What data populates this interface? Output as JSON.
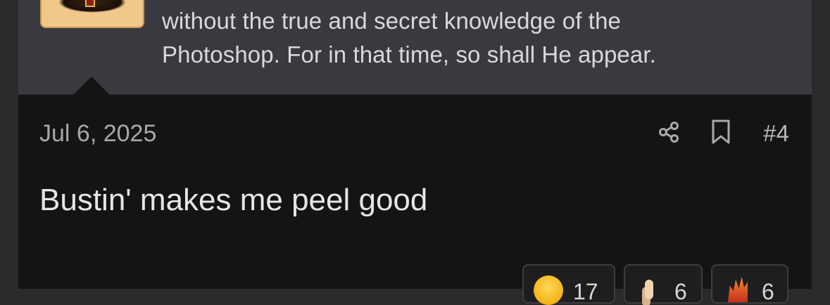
{
  "quote": {
    "line1": "without the true and secret knowledge of the",
    "line2": "Photoshop. For in that time, so shall He appear."
  },
  "post": {
    "date": "Jul 6, 2025",
    "number": "#4",
    "body": "Bustin' makes me peel good",
    "actions": {
      "share_icon": "share-icon",
      "bookmark_icon": "bookmark-icon"
    }
  },
  "reactions": [
    {
      "emoji": "laughing-emoji",
      "count": "17"
    },
    {
      "emoji": "thumbs-up-emoji",
      "count": "6"
    },
    {
      "emoji": "fire-emoji",
      "count": "6"
    }
  ],
  "colors": {
    "page_background": "#2a2a2d",
    "quote_background": "#393a3f",
    "post_background": "#141414",
    "text_primary": "#e6e6e8",
    "text_muted": "#a8a8ab"
  }
}
